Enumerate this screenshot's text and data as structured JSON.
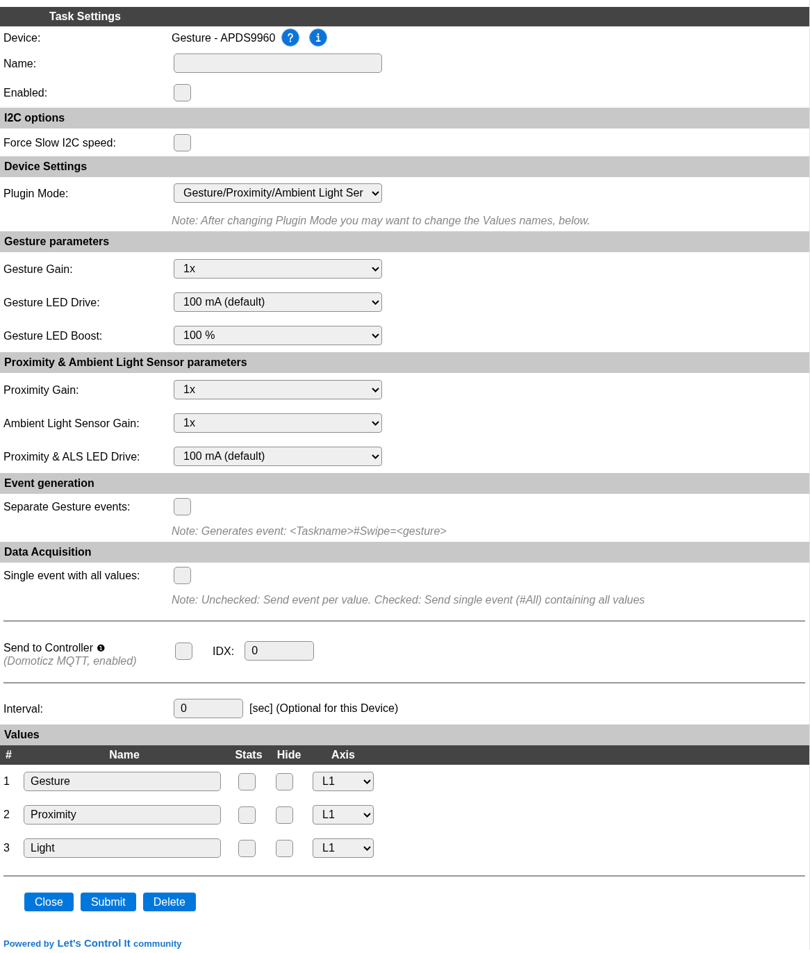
{
  "header": {
    "title": "Task Settings"
  },
  "general": [
    {
      "kind": "device",
      "label": "Device:",
      "value": "Gesture - APDS9960"
    },
    {
      "kind": "input",
      "label": "Name:"
    },
    {
      "kind": "checkbox",
      "label": "Enabled:",
      "checked": false
    }
  ],
  "sections": [
    {
      "heading": "I2C options",
      "rows": [
        {
          "kind": "checkbox",
          "label": "Force Slow I2C speed:",
          "checked": false
        }
      ]
    },
    {
      "heading": "Device Settings",
      "rows": [
        {
          "kind": "select",
          "label": "Plugin Mode:",
          "value": "Gesture/Proximity/Ambient Light Ser"
        },
        {
          "kind": "note",
          "text": "Note: After changing Plugin Mode you may want to change the Values names, below."
        }
      ]
    },
    {
      "heading": "Gesture parameters",
      "rows": [
        {
          "kind": "select",
          "label": "Gesture Gain:",
          "value": "1x"
        },
        {
          "kind": "select",
          "label": "Gesture LED Drive:",
          "value": "100 mA (default)"
        },
        {
          "kind": "select",
          "label": "Gesture LED Boost:",
          "value": "100 %"
        }
      ]
    },
    {
      "heading": "Proximity & Ambient Light Sensor parameters",
      "rows": [
        {
          "kind": "select",
          "label": "Proximity Gain:",
          "value": "1x"
        },
        {
          "kind": "select",
          "label": "Ambient Light Sensor Gain:",
          "value": "1x"
        },
        {
          "kind": "select",
          "label": "Proximity & ALS LED Drive:",
          "value": "100 mA (default)"
        }
      ]
    },
    {
      "heading": "Event generation",
      "rows": [
        {
          "kind": "checkbox",
          "label": "Separate Gesture events:",
          "checked": false
        },
        {
          "kind": "note",
          "text": "Note: Generates event: <Taskname>#Swipe=<gesture>"
        }
      ]
    },
    {
      "heading": "Data Acquisition",
      "rows": [
        {
          "kind": "checkbox",
          "label": "Single event with all values:",
          "checked": false
        },
        {
          "kind": "note",
          "text": "Note: Unchecked: Send event per value. Checked: Send single event (#All) containing all values"
        }
      ]
    }
  ],
  "controller": {
    "label": "Send to Controller",
    "marker": "❶",
    "detail": "(Domoticz MQTT, enabled)",
    "checked": false,
    "idx_label": "IDX:",
    "idx_value": "0"
  },
  "interval": {
    "label": "Interval:",
    "value": "0",
    "unit": "[sec] (Optional for this Device)"
  },
  "values": {
    "heading": "Values",
    "columns": [
      "#",
      "Name",
      "Stats",
      "Hide",
      "Axis"
    ],
    "rows": [
      {
        "number": "1",
        "name": "Gesture",
        "stats": false,
        "hide": false,
        "axis": "L1"
      },
      {
        "number": "2",
        "name": "Proximity",
        "stats": false,
        "hide": false,
        "axis": "L1"
      },
      {
        "number": "3",
        "name": "Light",
        "stats": false,
        "hide": false,
        "axis": "L1"
      }
    ]
  },
  "buttons": [
    {
      "label": "Close"
    },
    {
      "label": "Submit"
    },
    {
      "label": "Delete"
    }
  ],
  "footer": {
    "prefix": "Powered by",
    "brand": "Let's Control It",
    "suffix": "community"
  }
}
